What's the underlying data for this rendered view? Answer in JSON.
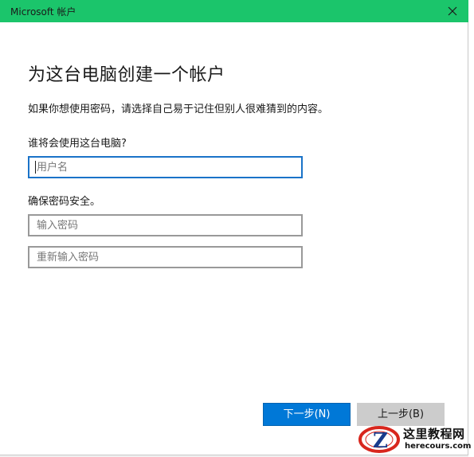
{
  "window": {
    "title": "Microsoft 帐户",
    "close_icon": "close-icon",
    "accent_color": "#1bc56b"
  },
  "main": {
    "heading": "为这台电脑创建一个帐户",
    "description": "如果你想使用密码，请选择自己易于记住但别人很难猜到的内容。",
    "who_label": "谁将会使用这台电脑?",
    "username_placeholder": "用户名",
    "secure_label": "确保密码安全。",
    "password_placeholder": "输入密码",
    "repassword_placeholder": "重新输入密码"
  },
  "buttons": {
    "next_label": "下一步(N)",
    "back_label": "上一步(B)",
    "next_color": "#0078d7"
  },
  "watermark": {
    "title": "这里教程网",
    "url": "herecours.com"
  },
  "background": {
    "glyph_top": "П",
    "glyph_bottom": "ﾐ"
  }
}
